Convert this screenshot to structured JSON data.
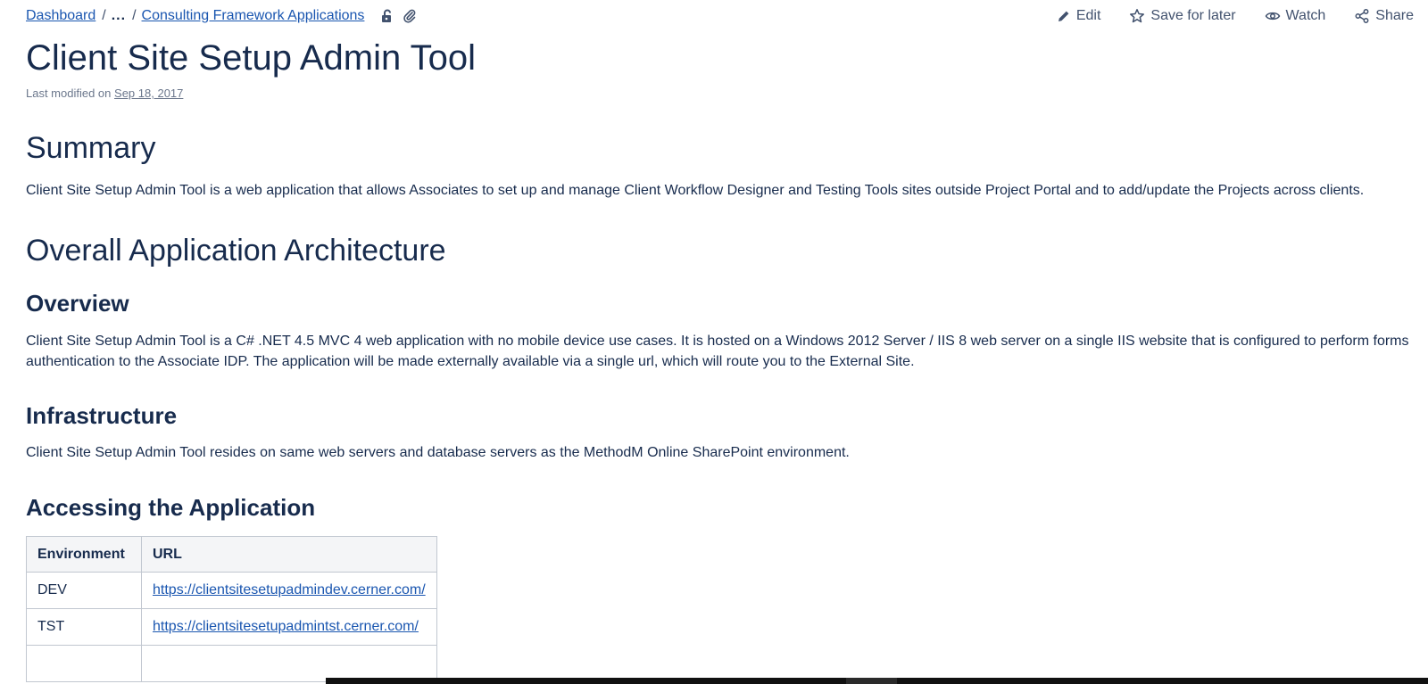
{
  "breadcrumb": {
    "items": [
      "Dashboard",
      "Consulting Framework Applications"
    ],
    "separator": "/",
    "ellipsis": "..."
  },
  "actions": {
    "edit": "Edit",
    "save_for_later": "Save for later",
    "watch": "Watch",
    "share": "Share"
  },
  "page": {
    "title": "Client Site Setup Admin Tool",
    "last_modified_label": "Last modified on",
    "last_modified_date": "Sep 18, 2017"
  },
  "summary": {
    "heading": "Summary",
    "text": "Client Site Setup Admin Tool is a web application that allows Associates to set up and manage Client Workflow Designer and Testing Tools sites outside Project Portal and to add/update the Projects across clients."
  },
  "architecture": {
    "heading": "Overall Application Architecture",
    "overview_heading": "Overview",
    "overview_text": "Client Site Setup Admin Tool is a C# .NET 4.5 MVC 4 web application with no mobile device use cases. It is hosted on a Windows 2012 Server / IIS 8 web server on a single IIS website that is configured to perform forms authentication to the Associate IDP. The application will be made externally available via a single url, which will route you to the External Site.",
    "infrastructure_heading": "Infrastructure",
    "infrastructure_text": "Client Site Setup Admin Tool resides on same web servers and database servers as the MethodM Online SharePoint environment."
  },
  "access": {
    "heading": "Accessing the Application",
    "columns": [
      "Environment",
      "URL"
    ],
    "rows": [
      {
        "env": "DEV",
        "url": "https://clientsitesetupadmindev.cerner.com/"
      },
      {
        "env": "TST",
        "url": "https://clientsitesetupadmintst.cerner.com/"
      }
    ]
  },
  "colors": {
    "link": "#1a56b0",
    "heading": "#172b4d",
    "muted": "#6b778c"
  },
  "icons": [
    "unlock-icon",
    "attachment-icon",
    "pencil-icon",
    "star-icon",
    "eye-icon",
    "share-icon"
  ]
}
